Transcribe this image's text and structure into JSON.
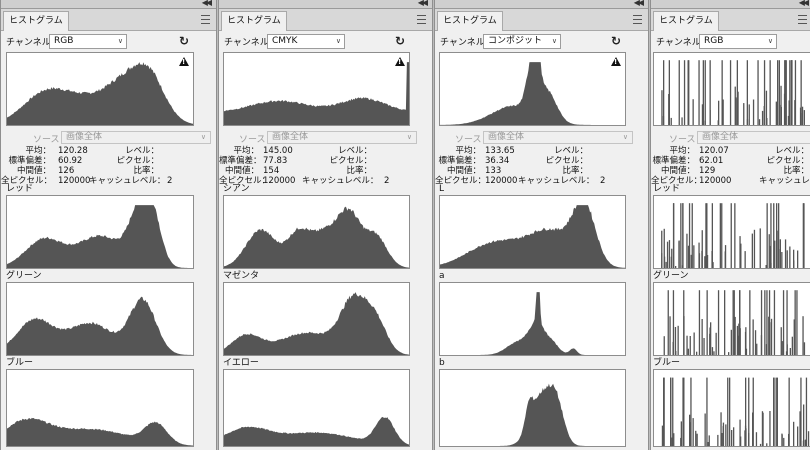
{
  "colors": {
    "bar": "#555555",
    "panel": "#f0f0f0"
  },
  "panels": [
    {
      "tab": "ヒストグラム",
      "channel_label": "チャンネル：",
      "channel": "RGB",
      "source_label": "ソース：",
      "source": "画像全体",
      "stats": {
        "mean_label": "平均：",
        "mean": "120.28",
        "std_label": "標準偏差：",
        "std": "60.92",
        "median_label": "中間値：",
        "median": "126",
        "pixels_label": "全ピクセル：",
        "pixels": "120000",
        "level_label": "レベル：",
        "count_label": "ピクセル：",
        "percent_label": "比率：",
        "cache_label": "キャッシュレベル：",
        "cache": "2"
      },
      "channels": [
        "レッド",
        "グリーン",
        "ブルー"
      ]
    },
    {
      "tab": "ヒストグラム",
      "channel_label": "チャンネル：",
      "channel": "CMYK",
      "source_label": "ソース：",
      "source": "画像全体",
      "stats": {
        "mean_label": "平均：",
        "mean": "145.00",
        "std_label": "標準偏差：",
        "std": "77.83",
        "median_label": "中間値：",
        "median": "154",
        "pixels_label": "全ピクセル：",
        "pixels": "120000",
        "level_label": "レベル：",
        "count_label": "ピクセル：",
        "percent_label": "比率：",
        "cache_label": "キャッシュレベル：",
        "cache": "2"
      },
      "channels": [
        "シアン",
        "マゼンタ",
        "イエロー"
      ]
    },
    {
      "tab": "ヒストグラム",
      "channel_label": "チャンネル：",
      "channel": "コンポジット",
      "source_label": "ソース：",
      "source": "画像全体",
      "stats": {
        "mean_label": "平均：",
        "mean": "133.65",
        "std_label": "標準偏差：",
        "std": "36.34",
        "median_label": "中間値：",
        "median": "133",
        "pixels_label": "全ピクセル：",
        "pixels": "120000",
        "level_label": "レベル：",
        "count_label": "ピクセル：",
        "percent_label": "比率：",
        "cache_label": "キャッシュレベル：",
        "cache": "2"
      },
      "channels": [
        "L",
        "a",
        "b"
      ]
    },
    {
      "tab": "ヒストグラム",
      "channel_label": "チャンネル：",
      "channel": "RGB",
      "source_label": "ソース：",
      "source": "画像全体",
      "stats": {
        "mean_label": "平均：",
        "mean": "120.07",
        "std_label": "標準偏差：",
        "std": "62.01",
        "median_label": "中間値：",
        "median": "129",
        "pixels_label": "全ピクセル：",
        "pixels": "120000",
        "level_label": "レベル：",
        "count_label": "ピクセル：",
        "percent_label": "比率：",
        "cache_label": "キャッシュレベル：",
        "cache": "2"
      },
      "channels": [
        "レッド",
        "グリーン",
        "ブルー"
      ]
    }
  ]
}
